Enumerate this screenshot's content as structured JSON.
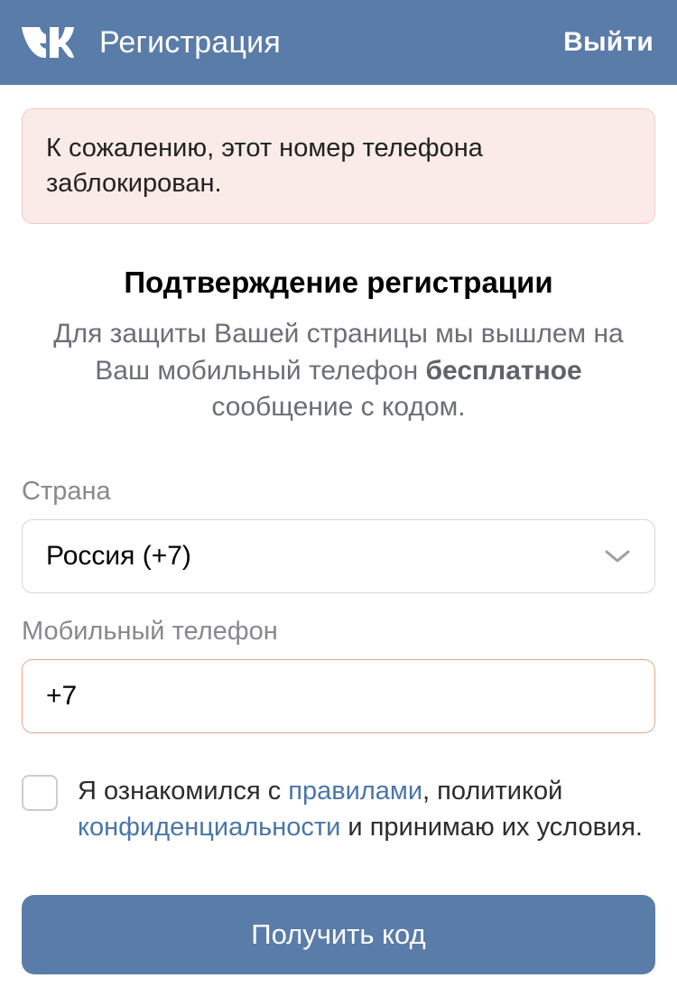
{
  "header": {
    "title": "Регистрация",
    "exit_label": "Выйти"
  },
  "alert": {
    "message": "К сожалению, этот номер телефона заблокирован."
  },
  "section": {
    "title": "Подтверждение регистрации",
    "desc_part1": "Для защиты Вашей страницы мы вышлем на Ваш мобильный телефон ",
    "desc_bold": "бесплатное",
    "desc_part2": " сообщение с кодом."
  },
  "form": {
    "country_label": "Страна",
    "country_value": "Россия (+7)",
    "phone_label": "Мобильный телефон",
    "phone_value": "+7"
  },
  "consent": {
    "part1": "Я ознакомился с ",
    "rules_link": "правилами",
    "part2": ", политикой ",
    "privacy_link": "конфиденциальности",
    "part3": " и принимаю их условия."
  },
  "submit": {
    "label": "Получить код"
  }
}
